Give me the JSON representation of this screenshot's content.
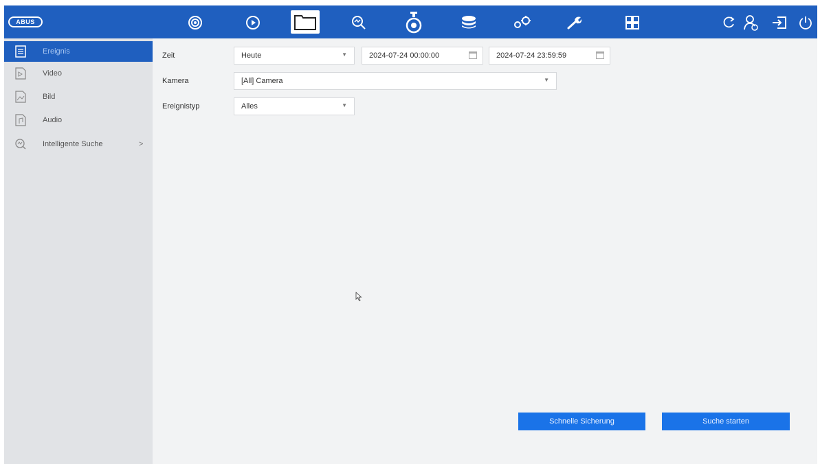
{
  "brand": {
    "logo_text": "ABUS",
    "accent": "#1f5fbf"
  },
  "topnav": {
    "icons": [
      "live-view-icon",
      "playback-icon",
      "file-management-icon",
      "smart-search-icon",
      "camera-icon",
      "storage-icon",
      "configuration-icon",
      "maintenance-icon",
      "multiview-icon",
      "refresh-icon",
      "user-icon",
      "logout-icon",
      "power-icon"
    ],
    "active": "file-management-icon"
  },
  "sidebar": {
    "items": [
      {
        "label": "Ereignis",
        "icon": "event-list-icon",
        "active": true
      },
      {
        "label": "Video",
        "icon": "video-file-icon",
        "active": false
      },
      {
        "label": "Bild",
        "icon": "image-file-icon",
        "active": false
      },
      {
        "label": "Audio",
        "icon": "audio-file-icon",
        "active": false
      },
      {
        "label": "Intelligente Suche",
        "icon": "smart-search-icon",
        "active": false,
        "chevron": ">"
      }
    ]
  },
  "form": {
    "zeit": {
      "label": "Zeit",
      "preset": "Heute",
      "start": "2024-07-24 00:00:00",
      "end": "2024-07-24 23:59:59"
    },
    "kamera": {
      "label": "Kamera",
      "value": "[All] Camera"
    },
    "ereignistyp": {
      "label": "Ereignistyp",
      "value": "Alles"
    }
  },
  "buttons": {
    "quick_backup": "Schnelle Sicherung",
    "start_search": "Suche starten"
  }
}
